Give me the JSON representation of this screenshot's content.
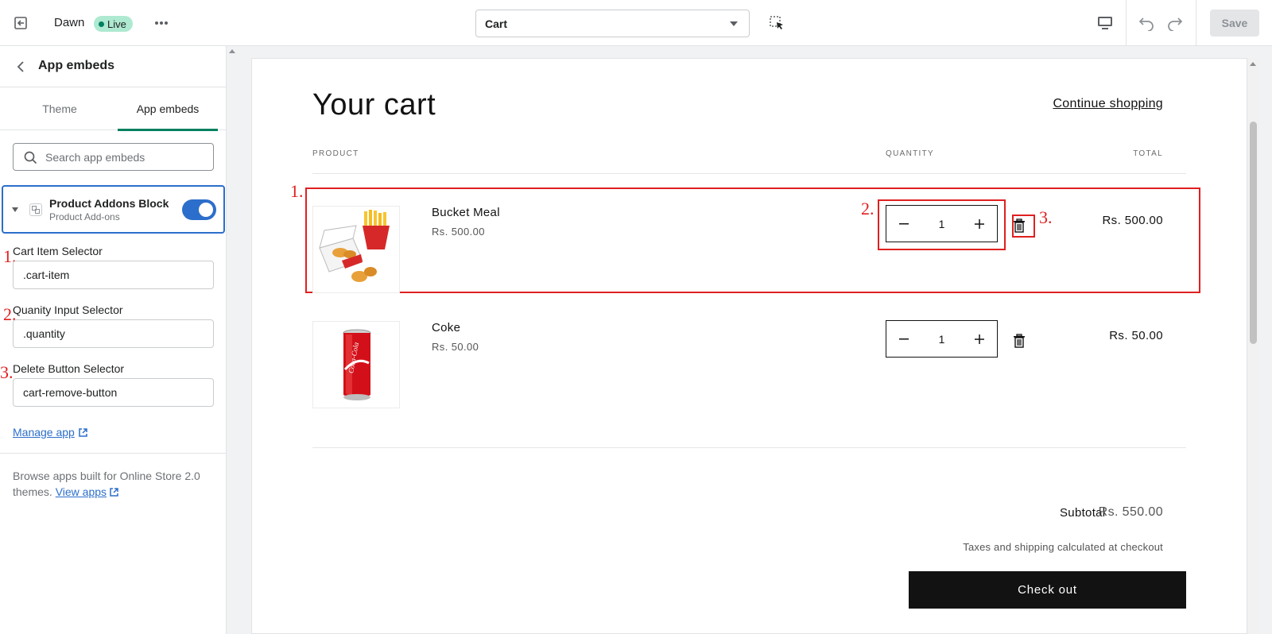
{
  "topbar": {
    "theme_name": "Dawn",
    "live_badge": "Live",
    "template_select": "Cart",
    "save_label": "Save"
  },
  "sidebar": {
    "title": "App embeds",
    "tabs": [
      {
        "label": "Theme",
        "active": false
      },
      {
        "label": "App embeds",
        "active": true
      }
    ],
    "search_placeholder": "Search app embeds",
    "embed": {
      "name": "Product Addons Block",
      "subtitle": "Product Add-ons",
      "enabled": true
    },
    "fields": [
      {
        "marker": "1.",
        "label": "Cart Item Selector",
        "value": ".cart-item"
      },
      {
        "marker": "2.",
        "label": "Quanity Input Selector",
        "value": ".quantity"
      },
      {
        "marker": "3.",
        "label": "Delete Button Selector",
        "value": "cart-remove-button"
      }
    ],
    "manage_link": "Manage app",
    "browse_text": "Browse apps built for Online Store 2.0 themes.",
    "view_apps_link": "View apps"
  },
  "preview": {
    "title": "Your cart",
    "continue_link": "Continue shopping",
    "headers": {
      "product": "PRODUCT",
      "quantity": "QUANTITY",
      "total": "TOTAL"
    },
    "annotations": [
      "1.",
      "2.",
      "3."
    ],
    "items": [
      {
        "name": "Bucket Meal",
        "price": "Rs. 500.00",
        "quantity": "1",
        "total": "Rs. 500.00",
        "image": "bucket-meal"
      },
      {
        "name": "Coke",
        "price": "Rs. 50.00",
        "quantity": "1",
        "total": "Rs. 50.00",
        "image": "coke-can"
      }
    ],
    "subtotal_label": "Subtotal",
    "subtotal_value": "Rs. 550.00",
    "tax_note": "Taxes and shipping calculated at checkout",
    "checkout_label": "Check out"
  },
  "colors": {
    "accent_blue": "#2c6ecb",
    "tab_active": "#008060",
    "live_badge_bg": "#aee9d1",
    "annotation_red": "#e02020",
    "checkout_bg": "#121212"
  }
}
